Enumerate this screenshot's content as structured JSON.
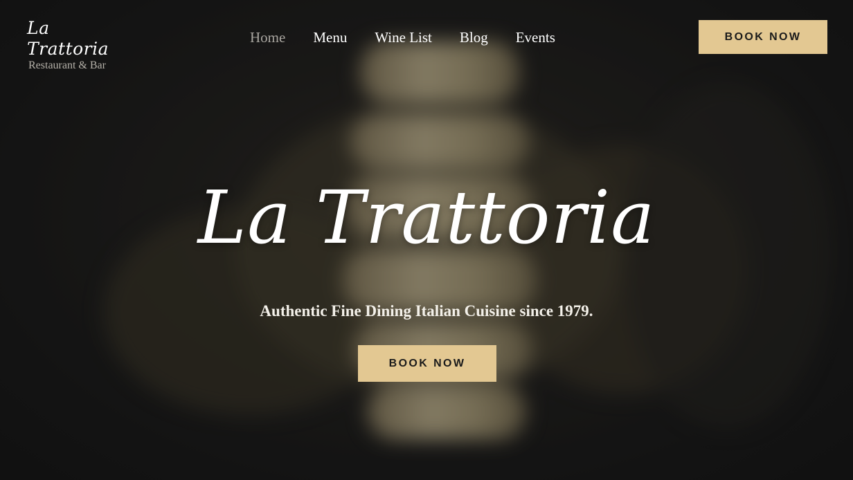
{
  "logo": {
    "script": "La Trattoria",
    "subtitle": "Restaurant & Bar"
  },
  "nav": {
    "items": [
      {
        "label": "Home",
        "active": true
      },
      {
        "label": "Menu",
        "active": false
      },
      {
        "label": "Wine List",
        "active": false
      },
      {
        "label": "Blog",
        "active": false
      },
      {
        "label": "Events",
        "active": false
      }
    ]
  },
  "header": {
    "book_label": "BOOK NOW"
  },
  "hero": {
    "title": "La Trattoria",
    "tagline": "Authentic Fine Dining Italian Cuisine since 1979.",
    "book_label": "BOOK NOW",
    "background_image": "pasta-on-fork-photo"
  },
  "colors": {
    "accent": "#e3c892",
    "text": "#ffffff",
    "nav_active": "#a8a59f",
    "background": "#1a1a1a"
  }
}
